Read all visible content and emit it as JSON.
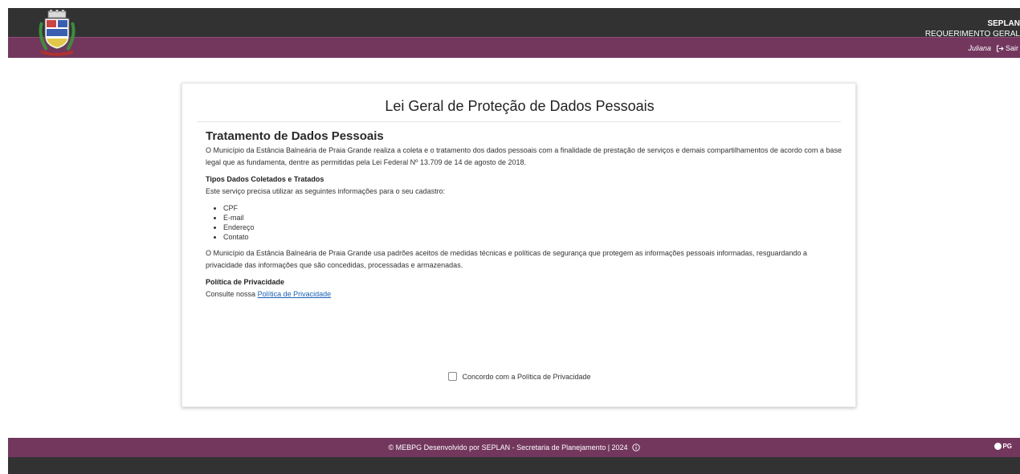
{
  "header": {
    "org": "SEPLAN",
    "system": "REQUERIMENTO GERAL",
    "user_name": "Juliana",
    "logout_label": "Sair"
  },
  "card": {
    "title": "Lei Geral de Proteção de Dados Pessoais",
    "section_title": "Tratamento de Dados Pessoais",
    "intro": "O Município da Estância Balneária de Praia Grande realiza a coleta e o tratamento dos dados pessoais com a finalidade de prestação de serviços e demais compartilhamentos de acordo com a base legal que as fundamenta, dentre as permitidas pela Lei Federal Nº 13.709 de 14 de agosto de 2018.",
    "types_heading": "Tipos Dados Coletados e Tratados",
    "types_intro": "Este serviço precisa utilizar as seguintes informações para o seu cadastro:",
    "items": [
      "CPF",
      "E-mail",
      "Endereço",
      "Contato"
    ],
    "security_text": "O Município da Estância Balneária de Praia Grande usa padrões aceitos de medidas técnicas e políticas de segurança que protegem as informações pessoais informadas, resguardando a privacidade das informações que são concedidas, processadas e armazenadas.",
    "policy_heading": "Política de Privacidade",
    "policy_prefix": "Consulte nossa",
    "policy_link": "Política de Privacidade",
    "agree_label": "Concordo com a Política de Privacidade"
  },
  "footer": {
    "text": "© MEBPG Desenvolvido por SEPLAN - Secretaria de Planejamento | 2024",
    "logo_text": "PG"
  },
  "colors": {
    "header_dark": "#323232",
    "brand_purple": "#73375e",
    "link": "#1a5fb4"
  }
}
